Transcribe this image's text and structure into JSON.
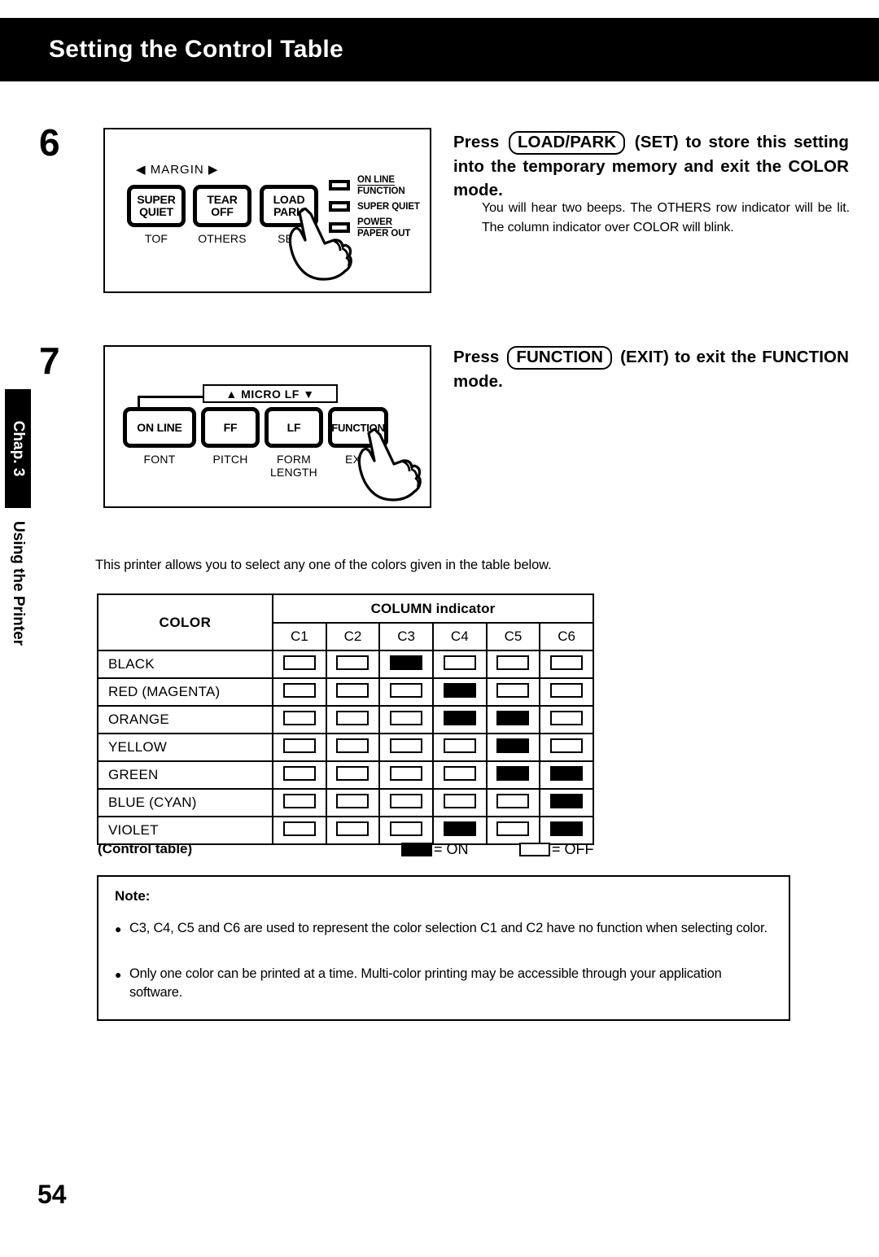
{
  "header": {
    "title": "Setting the Control Table"
  },
  "sidebar": {
    "chapter_tab": "Chap. 3",
    "section_label": "Using the Printer"
  },
  "steps": [
    {
      "number": "6",
      "instruction_prefix": "Press",
      "keycap": "LOAD/PARK",
      "instruction_suffix": "(SET) to store this setting into the temporary memory and exit the COLOR mode.",
      "detail": "You will hear two beeps. The OTHERS row indicator will be lit. The column indicator over COLOR will blink.",
      "panel": {
        "margin_label": "◀ MARGIN ▶",
        "buttons": [
          {
            "line1": "SUPER",
            "line2": "QUIET",
            "sublabel": "TOF"
          },
          {
            "line1": "TEAR",
            "line2": "OFF",
            "sublabel": "OTHERS"
          },
          {
            "line1": "LOAD",
            "line2": "PARK",
            "sublabel": "SET"
          }
        ],
        "leds": [
          {
            "line1": "ON LINE",
            "line2": "FUNCTION"
          },
          {
            "line1": "SUPER QUIET",
            "line2": ""
          },
          {
            "line1": "POWER",
            "line2": "PAPER OUT"
          }
        ],
        "pointer_icon": "pointing-hand-icon"
      }
    },
    {
      "number": "7",
      "instruction_prefix": "Press",
      "keycap": "FUNCTION",
      "instruction_suffix": "(EXIT) to exit the FUNCTION mode.",
      "detail": "",
      "panel": {
        "microlf_label": "▲ MICRO LF  ▼",
        "buttons": [
          {
            "line1": "ON LINE",
            "line2": "",
            "sublabel": "FONT"
          },
          {
            "line1": "FF",
            "line2": "",
            "sublabel": "PITCH"
          },
          {
            "line1": "LF",
            "line2": "",
            "sublabel": "FORM LENGTH"
          },
          {
            "line1": "FUNCTION",
            "line2": "",
            "sublabel": "EXIT"
          }
        ],
        "pointer_icon": "pointing-hand-icon"
      }
    }
  ],
  "intro_line": "This printer allows you to select any one of the colors given in the table below.",
  "chart_data": {
    "type": "table",
    "title": "Control table",
    "group_header": "COLUMN indicator",
    "row_header": "COLOR",
    "categories": [
      "C1",
      "C2",
      "C3",
      "C4",
      "C5",
      "C6"
    ],
    "rows": [
      {
        "name": "BLACK",
        "values": [
          0,
          0,
          1,
          0,
          0,
          0
        ]
      },
      {
        "name": "RED (MAGENTA)",
        "values": [
          0,
          0,
          0,
          1,
          0,
          0
        ]
      },
      {
        "name": "ORANGE",
        "values": [
          0,
          0,
          0,
          1,
          1,
          0
        ]
      },
      {
        "name": "YELLOW",
        "values": [
          0,
          0,
          0,
          0,
          1,
          0
        ]
      },
      {
        "name": "GREEN",
        "values": [
          0,
          0,
          0,
          0,
          1,
          1
        ]
      },
      {
        "name": "BLUE (CYAN)",
        "values": [
          0,
          0,
          0,
          0,
          0,
          1
        ]
      },
      {
        "name": "VIOLET",
        "values": [
          0,
          0,
          0,
          1,
          0,
          1
        ]
      }
    ],
    "legend": {
      "on": "= ON",
      "off": "= OFF"
    },
    "caption": "(Control table)"
  },
  "note": {
    "title": "Note:",
    "bullets": [
      "C3, C4, C5 and C6 are used to represent the color selection C1 and C2 have no function when selecting color.",
      "Only one color can be printed at a time. Multi-color printing may be accessible through your application software."
    ]
  },
  "page_number": "54"
}
